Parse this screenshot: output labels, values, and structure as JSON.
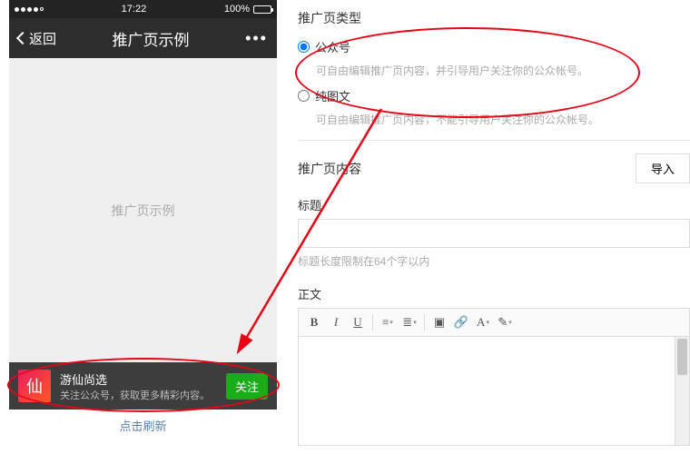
{
  "phone": {
    "status": {
      "time": "17:22",
      "battery": "100%"
    },
    "nav": {
      "back": "返回",
      "title": "推广页示例",
      "more": "•••"
    },
    "body_placeholder": "推广页示例",
    "banner": {
      "icon_text": "仙",
      "title": "游仙尚选",
      "subtitle": "关注公众号，获取更多精彩内容。",
      "button": "关注"
    },
    "footer": "点击刷新"
  },
  "panel": {
    "type_section": {
      "label": "推广页类型",
      "options": [
        {
          "label": "公众号",
          "desc": "可自由编辑推广页内容，并引导用户关注你的公众帐号。",
          "checked": true
        },
        {
          "label": "纯图文",
          "desc": "可自由编辑推广页内容，不能引导用户关注你的公众帐号。",
          "checked": false
        }
      ]
    },
    "content_section": {
      "label": "推广页内容",
      "import_btn": "导入",
      "title_label": "标题",
      "title_value": "",
      "title_hint": "标题长度限制在64个字以内",
      "body_label": "正文"
    }
  }
}
